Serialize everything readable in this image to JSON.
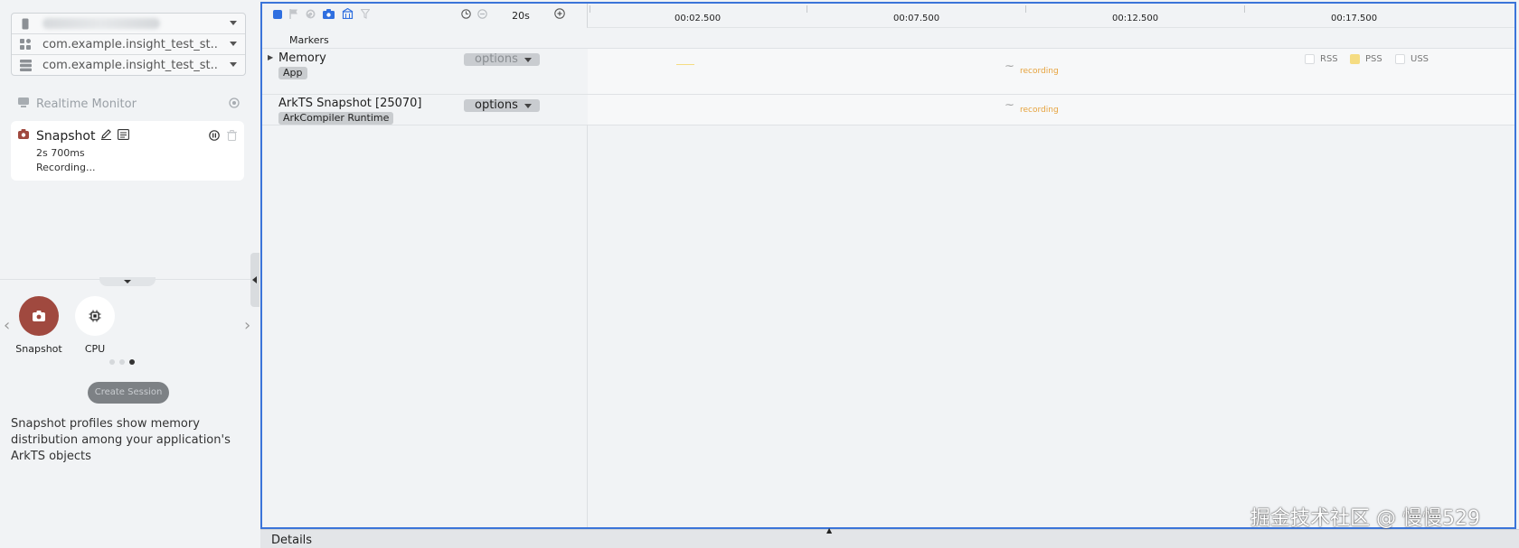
{
  "sidebar": {
    "selectors": [
      {
        "value": ""
      },
      {
        "value": "com.example.insight_test_st..."
      },
      {
        "value": "com.example.insight_test_st..."
      }
    ],
    "realtime_monitor": "Realtime Monitor",
    "session": {
      "title": "Snapshot",
      "duration": "2s 700ms",
      "status": "Recording..."
    },
    "templates": [
      {
        "label": "Snapshot",
        "icon": "camera-icon"
      },
      {
        "label": "CPU",
        "icon": "chip-icon"
      }
    ],
    "create_session": "Create Session",
    "description": "Snapshot profiles show memory distribution among your application's ArkTS objects"
  },
  "toolbar": {
    "zoom_value": "20s"
  },
  "timeline": {
    "ticks": [
      "00:02.500",
      "00:07.500",
      "00:12.500",
      "00:17.500"
    ]
  },
  "tracks": {
    "markers_label": "Markers",
    "memory": {
      "name": "Memory",
      "tag": "App",
      "options": "options",
      "status": "recording",
      "legend": [
        "RSS",
        "PSS",
        "USS"
      ]
    },
    "arkts": {
      "name": "ArkTS Snapshot [25070]",
      "tag": "ArkCompiler Runtime",
      "options": "options",
      "status": "recording"
    }
  },
  "details": {
    "label": "Details"
  },
  "watermark": "掘金技术社区 @ 慢慢529",
  "colors": {
    "accent": "#3b74d9",
    "snapshot_red": "#a0493f",
    "recording_orange": "#e6a23c",
    "pss_yellow": "#f5dc82"
  }
}
